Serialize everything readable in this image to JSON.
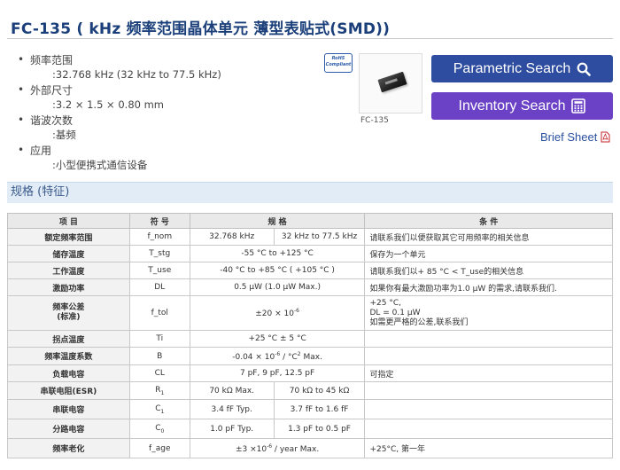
{
  "title": "FC-135 ( kHz 频率范围晶体单元 薄型表贴式(SMD))",
  "specs": [
    {
      "label": "频率范围",
      "value": ":32.768 kHz (32 kHz to 77.5 kHz)"
    },
    {
      "label": "外部尺寸",
      "value": ":3.2 × 1.5 × 0.80 mm"
    },
    {
      "label": "谐波次数",
      "value": ":基频"
    },
    {
      "label": "应用",
      "value": ":小型便携式通信设备"
    }
  ],
  "rohs_badge": {
    "line1": "RoHS",
    "line2": "Compliant"
  },
  "product_caption": "FC-135",
  "buttons": {
    "parametric": "Parametric Search",
    "inventory": "Inventory Search"
  },
  "brief_sheet": "Brief Sheet",
  "section_title": "规格 (特征)",
  "table": {
    "headers": {
      "item": "项 目",
      "symbol": "符 号",
      "spec": "规 格",
      "cond": "条 件"
    },
    "rows": {
      "nominal_freq": {
        "item": "额定频率范围",
        "symbol": "f_nom",
        "spec_a": "32.768 kHz",
        "spec_b": "32 kHz to 77.5 kHz",
        "cond": "请联系我们以便获取其它可用频率的相关信息"
      },
      "storage_temp": {
        "item": "储存温度",
        "symbol": "T_stg",
        "spec": "-55 °C to +125 °C",
        "cond": "保存为一个单元"
      },
      "operating_temp": {
        "item": "工作温度",
        "symbol": "T_use",
        "spec": "-40 °C to +85 °C ( +105 °C )",
        "cond": "请联系我们以+ 85 °C < T_use的相关信息"
      },
      "drive_level": {
        "item": "激励功率",
        "symbol": "DL",
        "spec": "0.5 μW (1.0 μW Max.)",
        "cond": "如果你有最大激励功率为1.0 μW 的需求,请联系我们."
      },
      "freq_tolerance": {
        "item": "频率公差",
        "item2": "(标准)",
        "symbol": "f_tol",
        "spec_pre": "±20 × 10",
        "spec_exp": "-6",
        "cond_1": "+25 °C,",
        "cond_2": "DL = 0.1 μW",
        "cond_3": "如需更严格的公差,联系我们"
      },
      "turnover_temp": {
        "item": "拐点温度",
        "symbol": "Ti",
        "spec": "+25 °C ± 5 °C",
        "cond": ""
      },
      "temp_coeff": {
        "item": "频率温度系数",
        "symbol": "B",
        "spec_pre": "-0.04 × 10",
        "spec_exp": "-6",
        "spec_mid": " / °C",
        "spec_exp2": "2",
        "spec_post": " Max.",
        "cond": ""
      },
      "load_cap": {
        "item": "负载电容",
        "symbol": "CL",
        "spec": "7 pF, 9 pF, 12.5 pF",
        "cond": "可指定"
      },
      "esr": {
        "item": "串联电阻(ESR)",
        "symbol_main": "R",
        "symbol_sub": "1",
        "spec_a": "70 kΩ Max.",
        "spec_b": "70 kΩ to 45 kΩ",
        "cond": ""
      },
      "motional_cap": {
        "item": "串联电容",
        "symbol_main": "C",
        "symbol_sub": "1",
        "spec_a": "3.4 fF Typ.",
        "spec_b": "3.7 fF to 1.6 fF",
        "cond": ""
      },
      "shunt_cap": {
        "item": "分路电容",
        "symbol_main": "C",
        "symbol_sub": "0",
        "spec_a": "1.0 pF Typ.",
        "spec_b": "1.3 pF to 0.5 pF",
        "cond": ""
      },
      "aging": {
        "item": "频率老化",
        "symbol": "f_age",
        "spec_pre": "±3 ×10",
        "spec_exp": "-6",
        "spec_post": " / year Max.",
        "cond": "+25°C, 第一年"
      }
    }
  },
  "colors": {
    "title": "#1a3f7a",
    "parametric_button": "#2e4da0",
    "inventory_button": "#6b41c6",
    "section_header_bg": "#e1ecf7",
    "table_header_bg": "#e9e9e9",
    "item_cell_bg": "#f2f2f2"
  },
  "icons": {
    "parametric": "search-icon",
    "inventory": "calculator-icon",
    "brief": "pdf-icon"
  }
}
